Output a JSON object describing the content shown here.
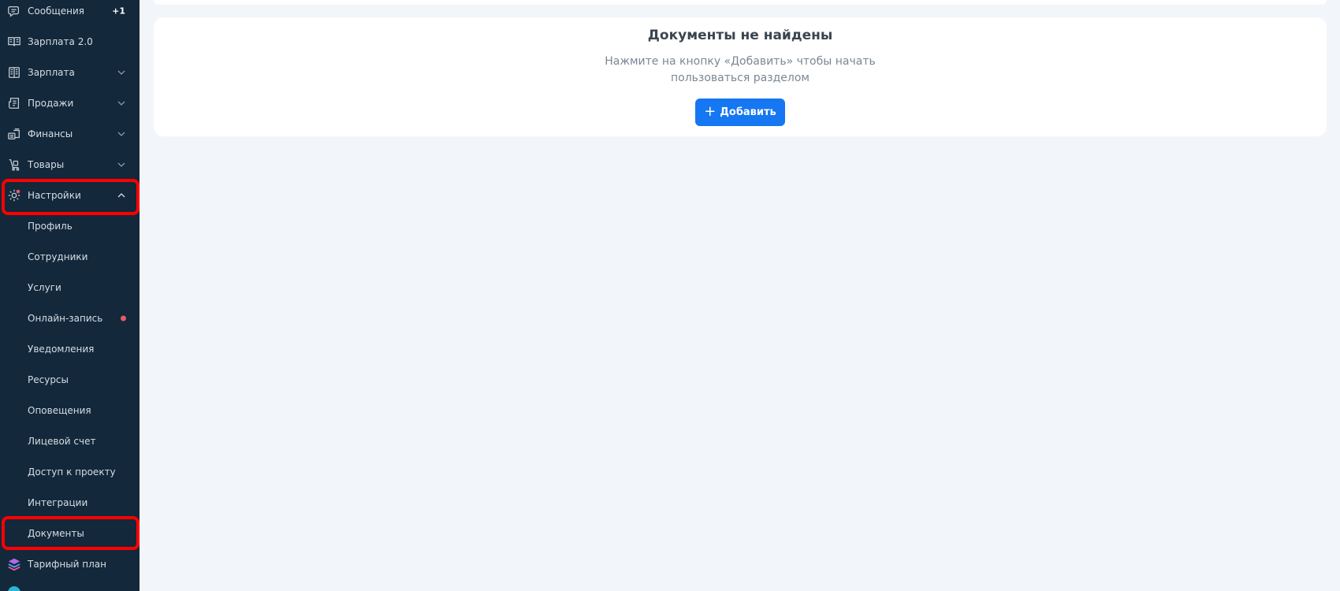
{
  "colors": {
    "sidebar_bg": "#13283a",
    "page_bg": "#f2f5f9",
    "primary": "#1677f2",
    "highlight": "#ff0000",
    "dot": "#e95a6a"
  },
  "sidebar": {
    "items": [
      {
        "id": "messages",
        "label": "Сообщения",
        "badge": "+1",
        "icon": "chat-icon"
      },
      {
        "id": "salary2",
        "label": "Зарплата 2.0",
        "icon": "book-icon"
      },
      {
        "id": "salary",
        "label": "Зарплата",
        "icon": "columns-icon",
        "expandable": true
      },
      {
        "id": "sales",
        "label": "Продажи",
        "icon": "receipt-icon",
        "expandable": true
      },
      {
        "id": "finance",
        "label": "Финансы",
        "icon": "coins-icon",
        "expandable": true
      },
      {
        "id": "goods",
        "label": "Товары",
        "icon": "cart-icon",
        "expandable": true
      },
      {
        "id": "settings",
        "label": "Настройки",
        "icon": "gear-icon",
        "expanded": true
      }
    ],
    "settings_subitems": [
      {
        "id": "profile",
        "label": "Профиль"
      },
      {
        "id": "employees",
        "label": "Сотрудники"
      },
      {
        "id": "services",
        "label": "Услуги"
      },
      {
        "id": "online-booking",
        "label": "Онлайн-запись",
        "dot": true
      },
      {
        "id": "notifications",
        "label": "Уведомления"
      },
      {
        "id": "resources",
        "label": "Ресурсы"
      },
      {
        "id": "alerts",
        "label": "Оповещения"
      },
      {
        "id": "account",
        "label": "Лицевой счет"
      },
      {
        "id": "project-access",
        "label": "Доступ к проекту"
      },
      {
        "id": "integrations",
        "label": "Интеграции"
      },
      {
        "id": "documents",
        "label": "Документы",
        "active": true
      }
    ],
    "bottom_items": [
      {
        "id": "tariff",
        "label": "Тарифный план",
        "icon": "layers-icon"
      }
    ]
  },
  "main": {
    "empty_state": {
      "title": "Документы не найдены",
      "text_line1": "Нажмите на кнопку «Добавить» чтобы начать",
      "text_line2": "пользоваться разделом",
      "add_button_label": "Добавить"
    }
  }
}
